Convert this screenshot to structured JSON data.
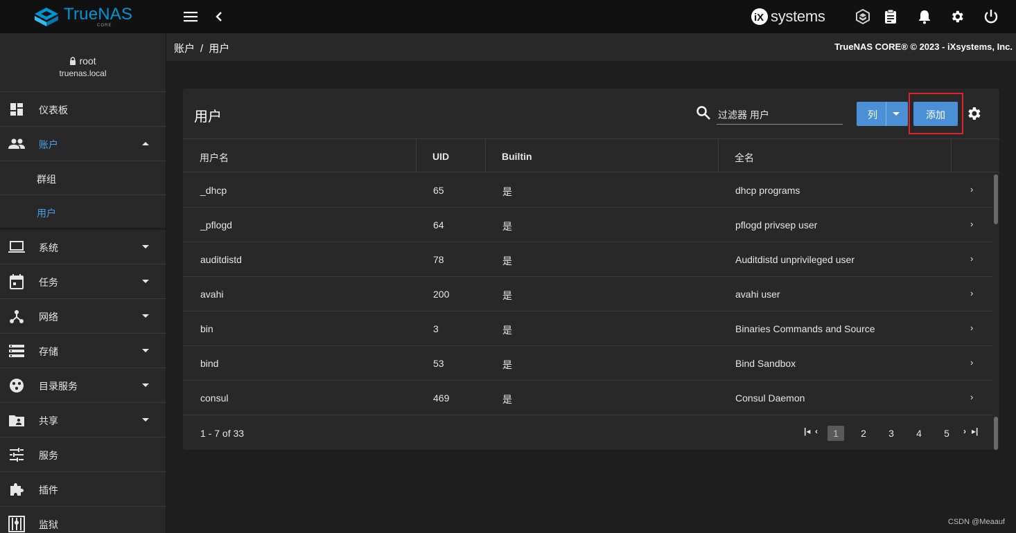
{
  "app": {
    "logo_main": "TrueNAS",
    "logo_sub": "CORE",
    "vendor_logo": "systems",
    "vendor_mark": "iX"
  },
  "topbar": {
    "icons": [
      "menu-icon",
      "chevron-left-icon",
      "truecommand-icon",
      "clipboard-icon",
      "bell-icon",
      "gear-icon",
      "power-icon"
    ]
  },
  "breadcrumb": {
    "level1": "账户",
    "separator": "/",
    "level2": "用户"
  },
  "copyright": "TrueNAS CORE® © 2023 - iXsystems, Inc.",
  "sidebar": {
    "user": "root",
    "host": "truenas.local",
    "items": [
      {
        "label": "仪表板",
        "icon": "dashboard-icon"
      },
      {
        "label": "账户",
        "icon": "people-icon"
      },
      {
        "label": "群组"
      },
      {
        "label": "用户"
      },
      {
        "label": "系统",
        "icon": "laptop-icon"
      },
      {
        "label": "任务",
        "icon": "calendar-icon"
      },
      {
        "label": "网络",
        "icon": "network-icon"
      },
      {
        "label": "存储",
        "icon": "storage-icon"
      },
      {
        "label": "目录服务",
        "icon": "directory-icon"
      },
      {
        "label": "共享",
        "icon": "folder-shared-icon"
      },
      {
        "label": "服务",
        "icon": "tune-icon"
      },
      {
        "label": "插件",
        "icon": "puzzle-icon"
      },
      {
        "label": "监狱",
        "icon": "jail-icon"
      }
    ]
  },
  "card": {
    "title": "用户",
    "filter_text": "过滤器 用户",
    "columns_button": "列",
    "add_button": "添加"
  },
  "table": {
    "headers": [
      "用户名",
      "UID",
      "Builtin",
      "全名"
    ],
    "rows": [
      {
        "username": "_dhcp",
        "uid": "65",
        "builtin": "是",
        "fullname": "dhcp programs"
      },
      {
        "username": "_pflogd",
        "uid": "64",
        "builtin": "是",
        "fullname": "pflogd privsep user"
      },
      {
        "username": "auditdistd",
        "uid": "78",
        "builtin": "是",
        "fullname": "Auditdistd unprivileged user"
      },
      {
        "username": "avahi",
        "uid": "200",
        "builtin": "是",
        "fullname": "avahi user"
      },
      {
        "username": "bin",
        "uid": "3",
        "builtin": "是",
        "fullname": "Binaries Commands and Source"
      },
      {
        "username": "bind",
        "uid": "53",
        "builtin": "是",
        "fullname": "Bind Sandbox"
      },
      {
        "username": "consul",
        "uid": "469",
        "builtin": "是",
        "fullname": "Consul Daemon"
      }
    ]
  },
  "pagination": {
    "range": "1 - 7 of 33",
    "pages": [
      "1",
      "2",
      "3",
      "4",
      "5"
    ],
    "current": "1"
  },
  "watermark": "CSDN @Meaauf",
  "colors": {
    "accent": "#4b90d4",
    "active_nav": "#4b9ee8",
    "highlight": "#e0242b",
    "logo": "#0095d5"
  }
}
